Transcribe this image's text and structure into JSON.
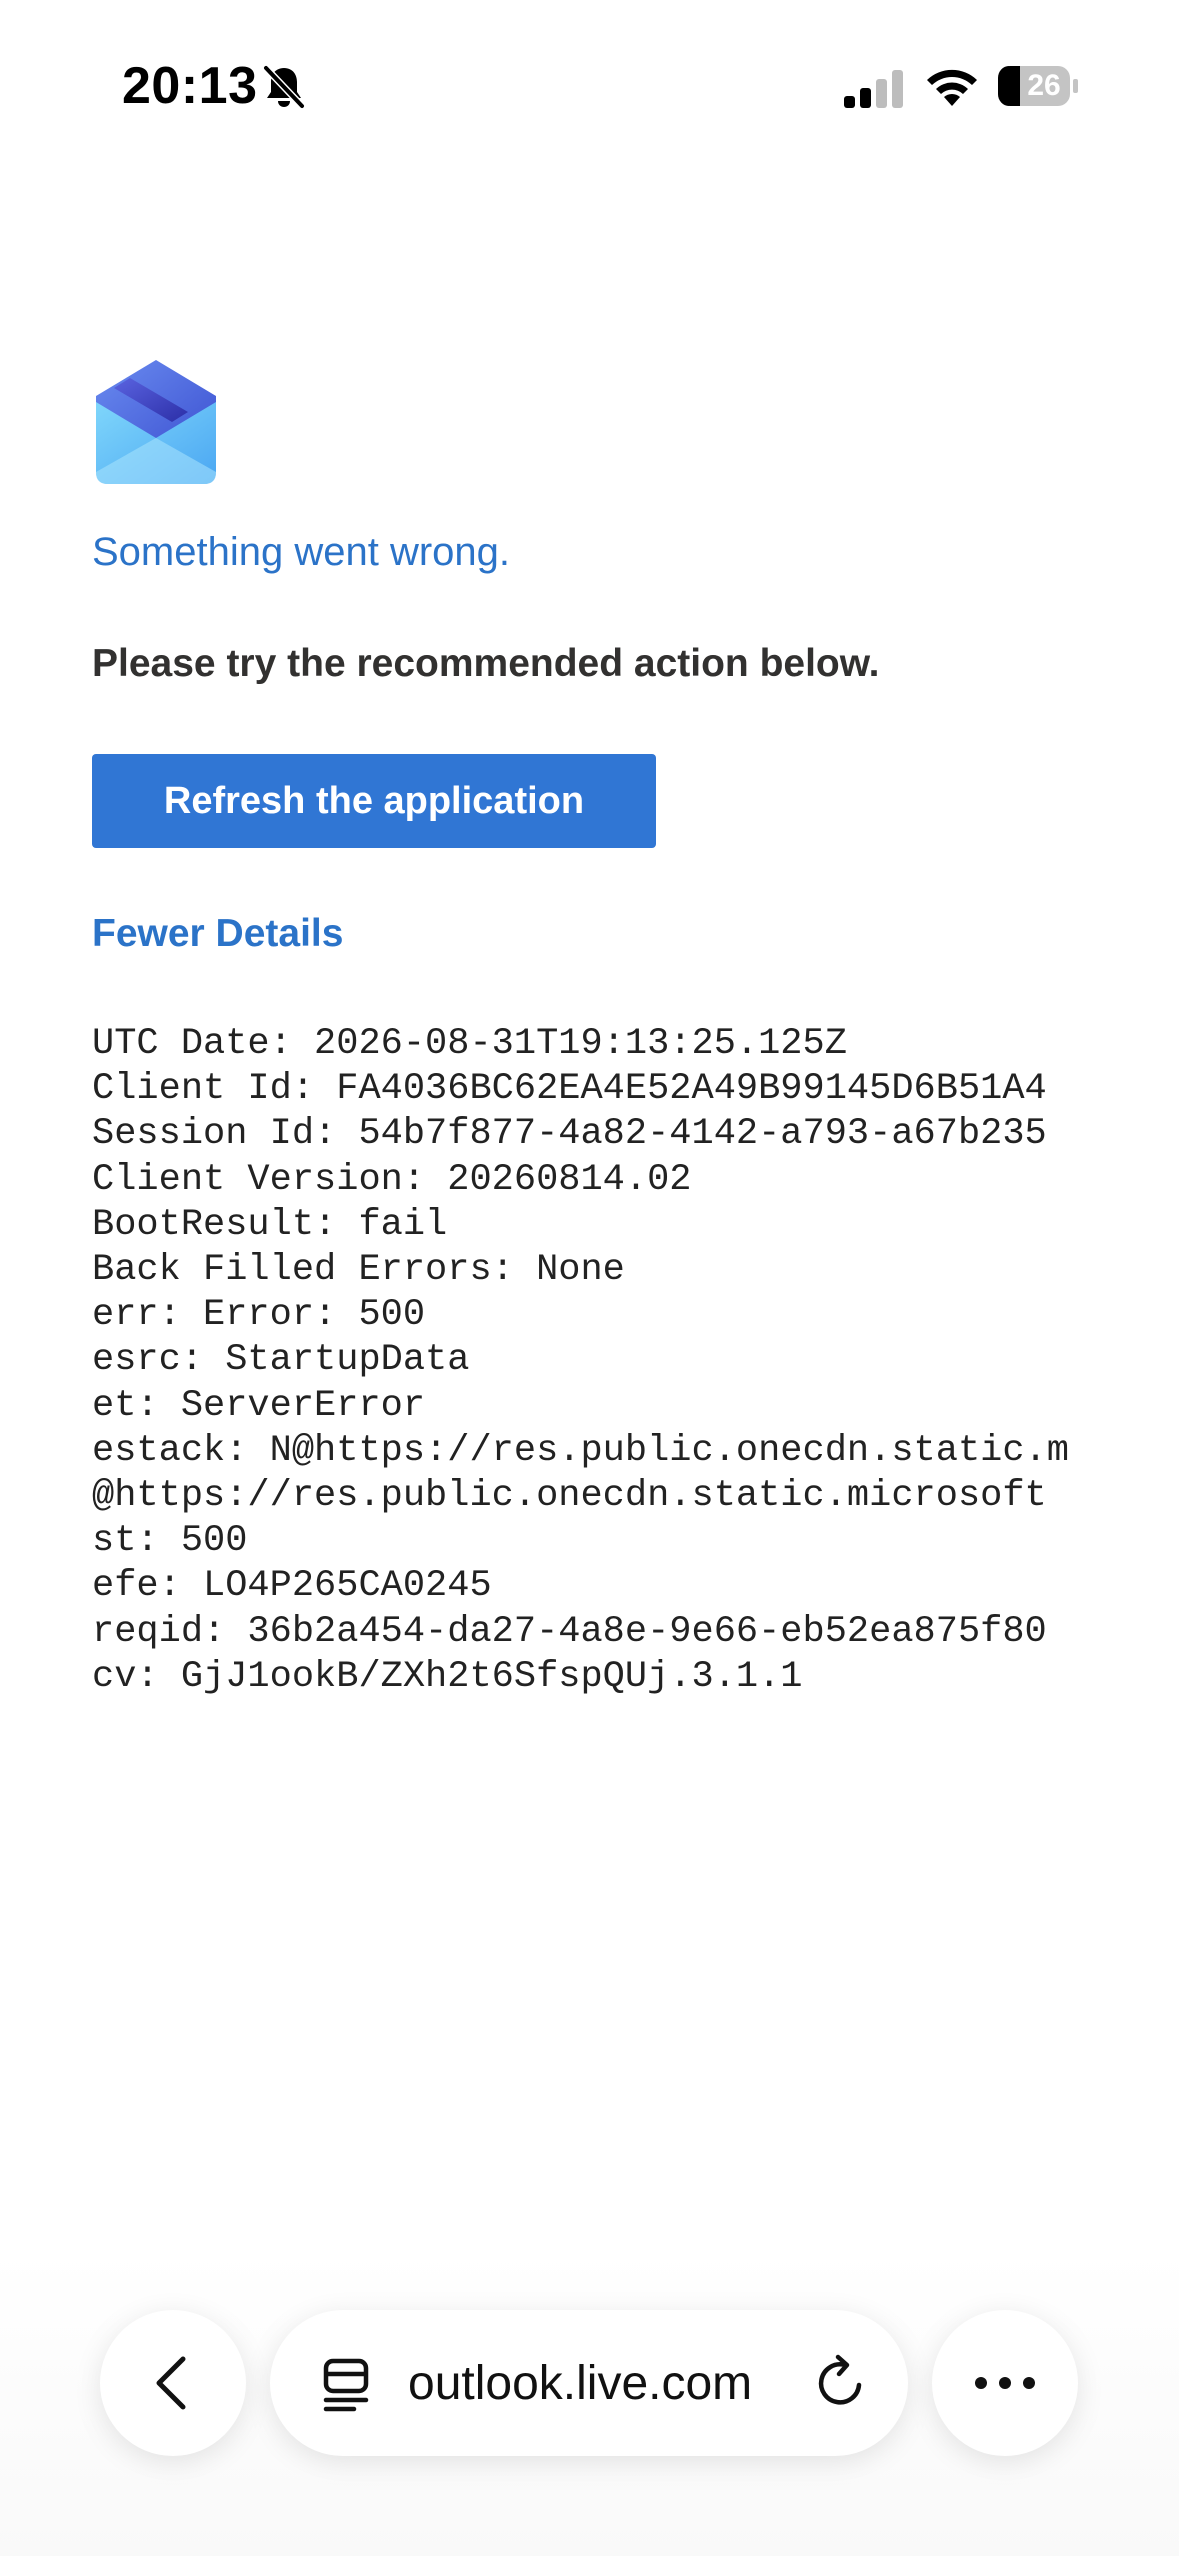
{
  "status_bar": {
    "time": "20:13",
    "battery_level": "26",
    "silent_mode": true
  },
  "error_page": {
    "logo_icon": "outlook-envelope-icon",
    "title": "Something went wrong.",
    "subtitle": "Please try the recommended action below.",
    "refresh_label": "Refresh the application",
    "details_toggle_label": "Fewer Details",
    "details": [
      "UTC Date: 2026-08-31T19:13:25.125Z",
      "Client Id: FA4036BC62EA4E52A49B99145D6B51A4",
      "Session Id: 54b7f877-4a82-4142-a793-a67b235",
      "Client Version: 20260814.02",
      "BootResult: fail",
      "Back Filled Errors: None",
      "err: Error: 500",
      "esrc: StartupData",
      "et: ServerError",
      "estack: N@https://res.public.onecdn.static.m",
      "@https://res.public.onecdn.static.microsoft",
      "st: 500",
      "efe: LO4P265CA0245",
      "reqid: 36b2a454-da27-4a8e-9e66-eb52ea875f80",
      "cv: GjJ1ookB/ZXh2t6SfspQUj.3.1.1"
    ]
  },
  "browser_toolbar": {
    "address": "outlook.live.com",
    "back_icon": "chevron-left-icon",
    "reader_icon": "reader-mode-icon",
    "reload_icon": "reload-icon",
    "more_icon": "more-icon"
  },
  "colors": {
    "accent_blue": "#2b73c8",
    "button_blue": "#3076d4",
    "text_dark": "#323130"
  }
}
